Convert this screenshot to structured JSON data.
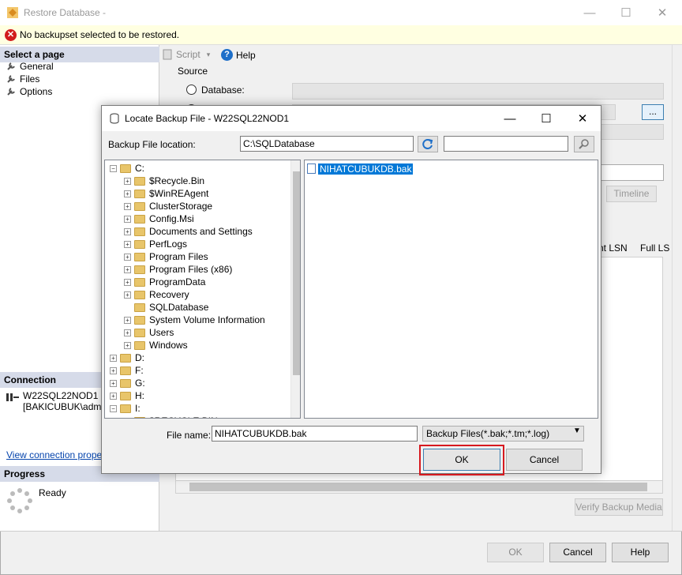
{
  "window": {
    "title": "Restore Database -"
  },
  "error": {
    "message": "No backupset selected to be restored."
  },
  "left": {
    "select_page": "Select a page",
    "pages": [
      "General",
      "Files",
      "Options"
    ],
    "connection_head": "Connection",
    "server": "W22SQL22NOD1",
    "user": "[BAKICUBUK\\admini",
    "view_connection": "View connection propertie",
    "progress_head": "Progress",
    "progress_status": "Ready"
  },
  "toolbar": {
    "script": "Script",
    "help": "Help"
  },
  "source": {
    "label": "Source",
    "database_label": "Database:"
  },
  "buttons": {
    "browse": "...",
    "timeline": "Timeline",
    "verify": "Verify Backup Media",
    "ok": "OK",
    "cancel": "Cancel",
    "help": "Help"
  },
  "grid": {
    "col_lsn": "nt LSN",
    "col_full": "Full LS"
  },
  "dialog": {
    "title": "Locate Backup File - W22SQL22NOD1",
    "location_label": "Backup File location:",
    "location_value": "C:\\SQLDatabase",
    "search_value": "",
    "tree": [
      {
        "label": "C:",
        "type": "drive",
        "expander": "−"
      },
      {
        "label": "$Recycle.Bin",
        "type": "folder",
        "expander": "+"
      },
      {
        "label": "$WinREAgent",
        "type": "folder",
        "expander": "+"
      },
      {
        "label": "ClusterStorage",
        "type": "folder",
        "expander": "+"
      },
      {
        "label": "Config.Msi",
        "type": "folder",
        "expander": "+"
      },
      {
        "label": "Documents and Settings",
        "type": "folder",
        "expander": "+"
      },
      {
        "label": "PerfLogs",
        "type": "folder",
        "expander": "+"
      },
      {
        "label": "Program Files",
        "type": "folder",
        "expander": "+"
      },
      {
        "label": "Program Files (x86)",
        "type": "folder",
        "expander": "+"
      },
      {
        "label": "ProgramData",
        "type": "folder",
        "expander": "+"
      },
      {
        "label": "Recovery",
        "type": "folder",
        "expander": "+"
      },
      {
        "label": "SQLDatabase",
        "type": "folder",
        "expander": ""
      },
      {
        "label": "System Volume Information",
        "type": "folder",
        "expander": "+"
      },
      {
        "label": "Users",
        "type": "folder",
        "expander": "+"
      },
      {
        "label": "Windows",
        "type": "folder",
        "expander": "+"
      },
      {
        "label": "D:",
        "type": "drive",
        "expander": "+"
      },
      {
        "label": "F:",
        "type": "drive",
        "expander": "+"
      },
      {
        "label": "G:",
        "type": "drive",
        "expander": "+"
      },
      {
        "label": "H:",
        "type": "drive",
        "expander": "+"
      },
      {
        "label": "I:",
        "type": "drive",
        "expander": "−"
      },
      {
        "label": "$RECYCLE.BIN",
        "type": "folder",
        "expander": "+"
      }
    ],
    "selected_file": "NIHATCUBUKDB.bak",
    "file_name_label": "File name:",
    "file_name_value": "NIHATCUBUKDB.bak",
    "file_type": "Backup Files(*.bak;*.tm;*.log)",
    "ok": "OK",
    "cancel": "Cancel"
  }
}
